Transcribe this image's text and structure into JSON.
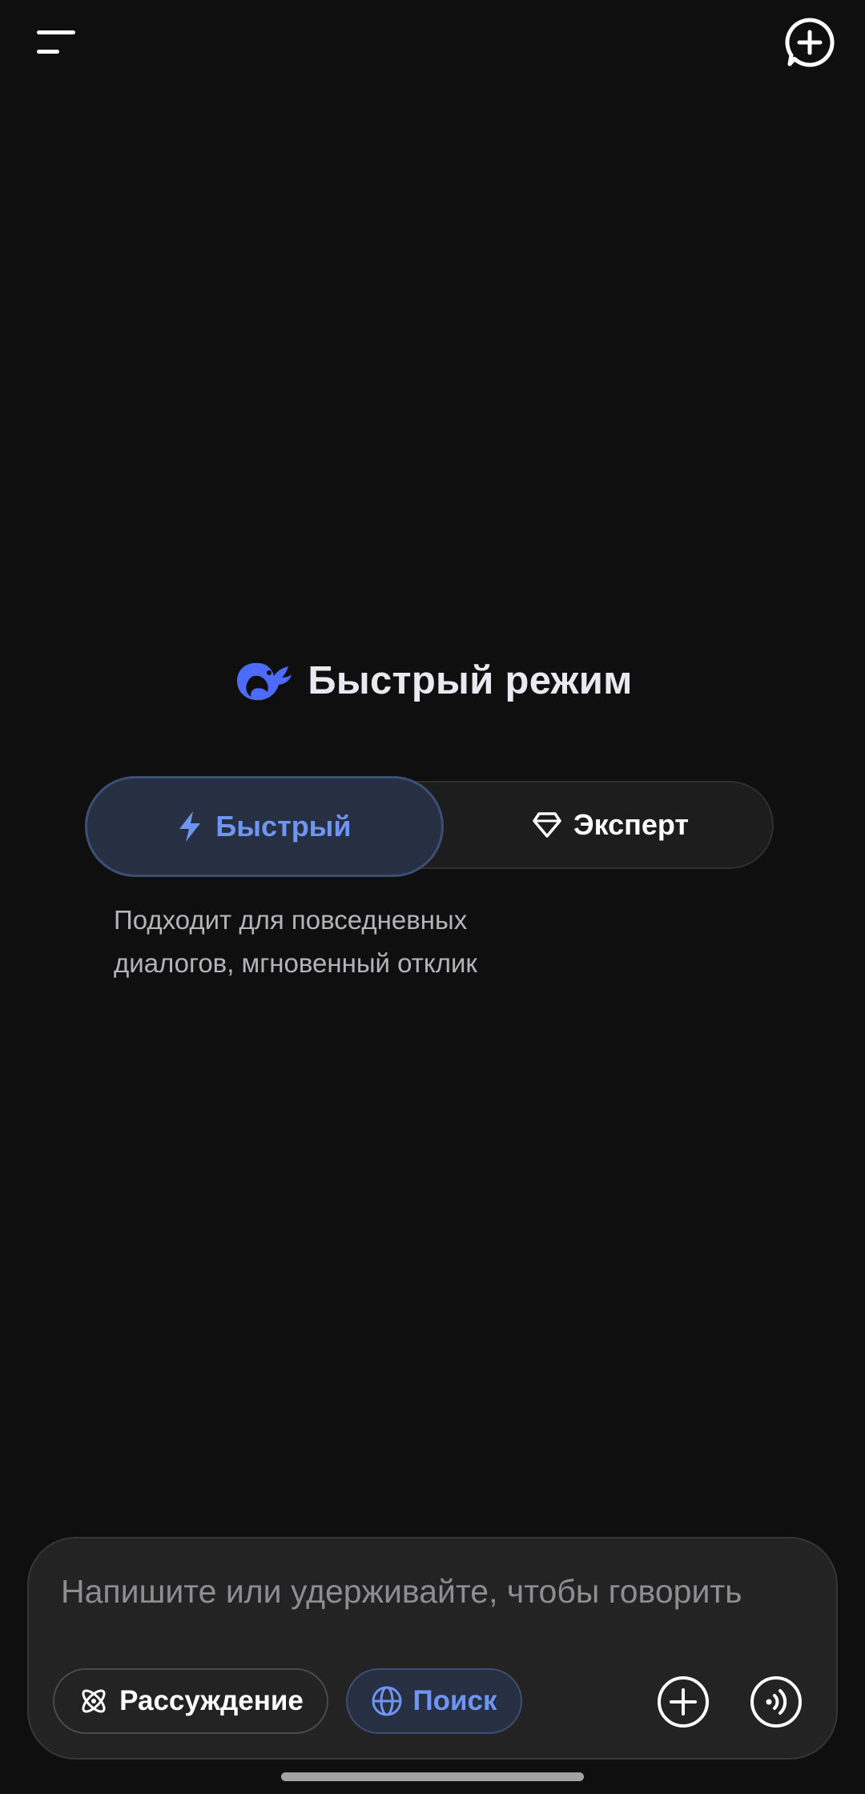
{
  "header": {
    "menu_icon": "menu-icon",
    "new_chat_icon": "new-chat-icon"
  },
  "title": {
    "logo": "deepseek-whale-logo",
    "text": "Быстрый режим"
  },
  "mode_switch": {
    "fast": {
      "label": "Быстрый",
      "icon": "lightning-icon",
      "selected": true
    },
    "expert": {
      "label": "Эксперт",
      "icon": "diamond-icon",
      "selected": false
    },
    "description": "Подходит для повседневных\nдиалогов, мгновенный отклик"
  },
  "composer": {
    "placeholder": "Напишите или удерживайте, чтобы говорить",
    "value": "",
    "think_button": {
      "label": "Рассуждение",
      "icon": "atom-icon",
      "active": false
    },
    "search_button": {
      "label": "Поиск",
      "icon": "globe-icon",
      "active": true
    },
    "attach_icon": "plus-circle-icon",
    "voice_icon": "voice-wave-icon"
  },
  "colors": {
    "background": "#0f0f0f",
    "accent": "#6f95f2",
    "accent_fill": "#273043",
    "text_primary": "#e9e9ef",
    "text_secondary": "#b4b4b8"
  }
}
